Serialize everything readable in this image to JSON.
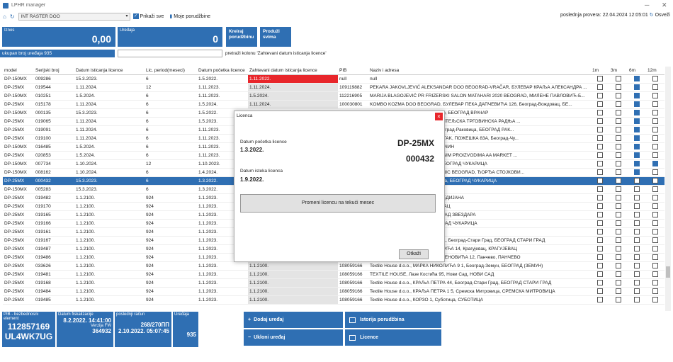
{
  "window": {
    "title": "LPHR manager",
    "minimize": "─",
    "close": "✕"
  },
  "toolbar": {
    "home_icon": "home-icon",
    "refresh_icon": "refresh-icon",
    "company": "INT RASTER DOO",
    "show_all": "Prikaži sve",
    "my_orders": "Moje porudžbine",
    "last_check": "poslednja provera: 22.04.2024 12:05:01",
    "refresh": "Osveži"
  },
  "kpi": {
    "amount_label": "Iznos",
    "amount_value": "0,00",
    "devices_label": "Uređaja",
    "devices_value": "0",
    "create_order": "Kreiraj porudžbinu",
    "extend_all": "Produži svima"
  },
  "total_label": "ukupan broj uređaja 935",
  "filter_hint": "pretraži kolonu 'Zahtevani datum isticanja licence'",
  "table": {
    "headers": [
      "model",
      "Serijski broj",
      "Datum isticanja licence",
      "Lic. period(meseci)",
      "Datum početka licence",
      "Zahtevani datum isticanja licence",
      "PIB",
      "Naziv i adresa",
      "1m",
      "3m",
      "6m",
      "12m"
    ],
    "rows": [
      {
        "c": [
          "DP-150MX",
          "009286",
          "15.3.2023.",
          "6",
          "1.5.2022.",
          "1.11.2022.",
          "null",
          "null"
        ],
        "cb": [
          0,
          0,
          1,
          0
        ],
        "req": "red"
      },
      {
        "c": [
          "DP-25MX",
          "019544",
          "1.11.2024.",
          "12",
          "1.11.2023.",
          "1.11.2024.",
          "109119882",
          "PEKARA JAKOVLJEVIĆ ALEKSANDAR DOO BEOGRAD-VRAČAR, БУЛЕВАР КРАЉА АЛЕКСАНДРА ..."
        ],
        "cb": [
          0,
          0,
          1,
          0
        ],
        "req": "grey"
      },
      {
        "c": [
          "DP-150MX",
          "010251",
          "1.5.2024.",
          "6",
          "1.11.2023.",
          "1.5.2024.",
          "112216905",
          "MARIJA BLAGOJEVIĆ PR FRIZERSKI SALON MATAHARI 2020 BEOGRAD, МИЛЕНЕ ПАВЛОВИЋ-Б..."
        ],
        "cb": [
          0,
          0,
          1,
          0
        ],
        "req": "grey"
      },
      {
        "c": [
          "DP-25MX",
          "015178",
          "1.11.2024.",
          "6",
          "1.5.2024.",
          "1.11.2024.",
          "100030801",
          "KOMBO KOZMA DOO BEOGRAD, БУЛЕВАР ПЕКА ДАПЧЕВИЋА 126, Београд-Вождовац, БЕ..."
        ],
        "cb": [
          0,
          0,
          1,
          0
        ],
        "req": "grey"
      },
      {
        "c": [
          "DP-150MX",
          "000135",
          "15.3.2023.",
          "6",
          "1.5.2022.",
          "",
          "",
          "ЈАКЕНЗИЈЕВА 17, Београд-Врачар, БЕОГРАД ВРАЧАР"
        ],
        "cb": [
          0,
          0,
          1,
          0
        ],
        "req": ""
      },
      {
        "c": [
          "DP-25MX",
          "019065",
          "1.11.2024.",
          "6",
          "1.5.2023.",
          "",
          "",
          "ЈА ЗАНАТСКА ПЕКАРСКО УГОСТИТЕЉСКА ТРГОВИНСКА РАДЊА ..."
        ],
        "cb": [
          0,
          0,
          1,
          0
        ],
        "req": ""
      },
      {
        "c": [
          "DP-25MX",
          "019091",
          "1.11.2024.",
          "6",
          "1.11.2023.",
          "",
          "",
          "ТРАГ, КНЕЗА ВИШЕСЛАВА 63, Београд-Раковица, БЕОГРАД РАК..."
        ],
        "cb": [
          0,
          0,
          1,
          0
        ],
        "req": ""
      },
      {
        "c": [
          "DP-25MX",
          "019100",
          "1.11.2024.",
          "6",
          "1.11.2023.",
          "",
          "",
          "FAIR PLAY PAVLOVIĆ DEJAN I ORTAK, ПОЖЕШКА 83А, Београд-Чу..."
        ],
        "cb": [
          0,
          0,
          1,
          0
        ],
        "req": ""
      },
      {
        "c": [
          "DP-150MX",
          "016485",
          "1.5.2024.",
          "6",
          "1.11.2023.",
          "",
          "",
          "НОВЕМБРА 6, Београд-Гроцка, ВРЧИН"
        ],
        "cb": [
          0,
          0,
          1,
          0
        ],
        "req": ""
      },
      {
        "c": [
          "DP-25MX",
          "020853",
          "1.5.2024.",
          "6",
          "1.11.2023.",
          "",
          "",
          "RGOVINA NA MALO PREHRAMBENIM PROIZVODIMA AA MARKET ..."
        ],
        "cb": [
          0,
          0,
          1,
          0
        ],
        "req": ""
      },
      {
        "c": [
          "DP-150MX",
          "007734",
          "1.10.2024.",
          "12",
          "1.10.2023.",
          "",
          "",
          "ЈОВИЋА 10, Београд-Чукарица, БЕОГРАД ЧУКАРИЦА"
        ],
        "cb": [
          0,
          0,
          1,
          1
        ],
        "req": ""
      },
      {
        "c": [
          "DP-150MX",
          "008162",
          "1.10.2024.",
          "6",
          "1.4.2024.",
          "",
          "",
          "ERVIS BELE TEHNIKE INTERTRONIC BEOGRAD, ЂОРЂА СТОЈКОВИ..."
        ],
        "cb": [
          0,
          0,
          1,
          0
        ],
        "req": ""
      },
      {
        "c": [
          "DP-25MX",
          "000432",
          "15.3.2023.",
          "6",
          "1.3.2022.",
          "",
          "",
          "ТРГОВАЧКА 308, Београд-Чукарица, БЕОГРАД ЧУКАРИЦА"
        ],
        "cb": [
          0,
          0,
          0,
          0
        ],
        "req": "",
        "sel": true
      },
      {
        "c": [
          "DP-150MX",
          "005283",
          "15.3.2023.",
          "6",
          "1.3.2022.",
          "",
          "",
          ""
        ],
        "cb": [
          0,
          0,
          0,
          0
        ],
        "req": ""
      },
      {
        "c": [
          "DP-25MX",
          "019482",
          "1.1.2100.",
          "924",
          "1.1.2023.",
          "",
          "",
          "УШАНА 9, Ниш-Медијана, НИШ МЕДИЈАНА"
        ],
        "cb": [
          0,
          0,
          0,
          0
        ],
        "req": ""
      },
      {
        "c": [
          "DP-25MX",
          "019170",
          "1.1.2100.",
          "924",
          "1.1.2023.",
          "",
          "",
          "ЗАЧКИХ ЖРТАВА 66, Шабац, ШАБАЦ"
        ],
        "cb": [
          0,
          0,
          0,
          0
        ],
        "req": ""
      },
      {
        "c": [
          "DP-25MX",
          "019165",
          "1.1.2100.",
          "924",
          "1.1.2023.",
          "",
          "",
          "ВА 19А, Београд-Звездара, БЕОГРАД ЗВЕЗДАРА"
        ],
        "cb": [
          0,
          0,
          0,
          0
        ],
        "req": ""
      },
      {
        "c": [
          "DP-25MX",
          "019166",
          "1.1.2100.",
          "924",
          "1.1.2023.",
          "",
          "",
          "ЦКА 60, Београд-Чукарица, БЕОГРАД ЧУКАРИЦА"
        ],
        "cb": [
          0,
          0,
          0,
          0
        ],
        "req": ""
      },
      {
        "c": [
          "DP-25MX",
          "019161",
          "1.1.2100.",
          "924",
          "1.1.2023.",
          "",
          "",
          "А 38, Краљево, КРАЉЕВО"
        ],
        "cb": [
          0,
          0,
          0,
          0
        ],
        "req": ""
      },
      {
        "c": [
          "DP-25MX",
          "019167",
          "1.1.2100.",
          "924",
          "1.1.2023.",
          "1.1.2100.",
          "108059166",
          "Textile House d.o.o., НУШИЋЕВА 11, Београд-Стари Град, БЕОГРАД СТАРИ ГРАД"
        ],
        "cb": [
          0,
          0,
          0,
          0
        ],
        "req": "grey"
      },
      {
        "c": [
          "DP-25MX",
          "019487",
          "1.1.2100.",
          "924",
          "1.1.2023.",
          "1.1.2100.",
          "108059166",
          "Textile House d.o.o., НИКОЛЕ ПАШИЋА 14, Крагујевац, КРАГУЈЕВАЦ"
        ],
        "cb": [
          0,
          0,
          0,
          0
        ],
        "req": "grey"
      },
      {
        "c": [
          "DP-25MX",
          "019486",
          "1.1.2100.",
          "924",
          "1.1.2023.",
          "1.1.2100.",
          "108059166",
          "Textile House d.o.o., МИЛОША ОБРЕНОВИЋА 12, Панчево, ПАНЧЕВО"
        ],
        "cb": [
          0,
          0,
          0,
          0
        ],
        "req": "grey"
      },
      {
        "c": [
          "DP-25MX",
          "033626",
          "1.1.2100.",
          "924",
          "1.1.2023.",
          "1.1.2100.",
          "108059166",
          "Textile House d.o.o., МАРКА НИКОЛИЋА 9 1, Београд-Земун, БЕОГРАД (ЗЕМУН)"
        ],
        "cb": [
          0,
          0,
          0,
          0
        ],
        "req": "grey"
      },
      {
        "c": [
          "DP-25MX",
          "019481",
          "1.1.2100.",
          "924",
          "1.1.2023.",
          "1.1.2100.",
          "108059166",
          "TEXTILE HOUSE, Лазе Костића 95, Нови Сад, НОВИ САД"
        ],
        "cb": [
          0,
          0,
          0,
          0
        ],
        "req": "grey"
      },
      {
        "c": [
          "DP-25MX",
          "019168",
          "1.1.2100.",
          "924",
          "1.1.2023.",
          "1.1.2100.",
          "108059166",
          "Textile House d.o.o., КРАЉА ПЕТРА 44, Београд-Стари Град, БЕОГРАД СТАРИ ГРАД"
        ],
        "cb": [
          0,
          0,
          0,
          0
        ],
        "req": "grey"
      },
      {
        "c": [
          "DP-25MX",
          "019484",
          "1.1.2100.",
          "924",
          "1.1.2023.",
          "1.1.2100.",
          "108059166",
          "Textile House d.o.o., КРАЉА ПЕТРА 1 5, Сремска Митровица, СРЕМСКА МИТРОВИЦА"
        ],
        "cb": [
          0,
          0,
          0,
          0
        ],
        "req": "grey"
      },
      {
        "c": [
          "DP-25MX",
          "019485",
          "1.1.2100.",
          "924",
          "1.1.2023.",
          "1.1.2100.",
          "108059166",
          "Textile House d.o.o., КОРЗО 1, Суботица, СУБОТИЦА"
        ],
        "cb": [
          0,
          0,
          0,
          0
        ],
        "req": "grey"
      }
    ]
  },
  "bottom": {
    "pib_label": "PIB - bezbednosni element",
    "pib": "112857169",
    "security": "UL4WK7UG",
    "fisc_label": "Datum fiskalizacije",
    "fisc_date": "8.2.2022. 14:41:00",
    "fw_label": "Verzija FW",
    "fw": "364932",
    "last_label": "poslednji račun",
    "last_receipt": "268/270ПП",
    "last_date": "2.10.2022. 05:07:45",
    "dev_label": "Uređaja",
    "dev_count": "935",
    "add_device": "Dodaj uređaj",
    "remove_device": "Ukloni uređaj",
    "order_history": "Istorija porudžbina",
    "license": "Licence"
  },
  "dialog": {
    "title": "Licenca",
    "close": "×",
    "start_label": "Datum početka licence",
    "start_value": "1.3.2022.",
    "end_label": "Datum isteka licenca",
    "end_value": "1.9.2022.",
    "model": "DP-25MX",
    "serial": "000432",
    "change_button": "Promeni licencu na tekući mesec",
    "cancel": "Otkaži"
  },
  "colors": {
    "accent": "#2f6fb3",
    "alert": "#e8262b"
  }
}
